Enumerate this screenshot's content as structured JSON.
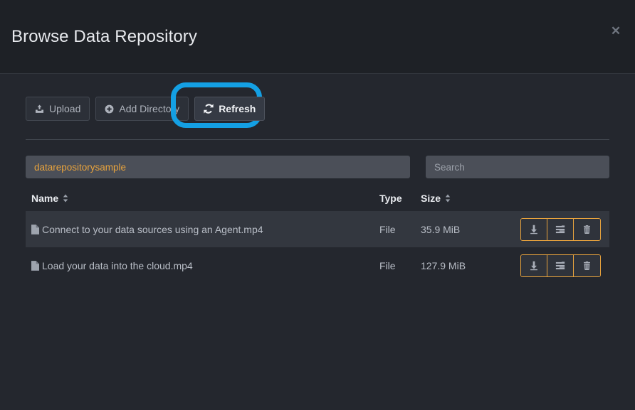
{
  "modal": {
    "title": "Browse Data Repository",
    "close_label": "✕"
  },
  "toolbar": {
    "upload_label": "Upload",
    "add_directory_label": "Add Directory",
    "refresh_label": "Refresh",
    "upload_icon": "upload-icon",
    "add_directory_icon": "plus-circle-icon",
    "refresh_icon": "refresh-icon",
    "highlight_color": "#14a0e4",
    "highlighted_button": "Refresh"
  },
  "filters": {
    "path": "datarepositorysample",
    "path_color": "#e8a33d",
    "search_value": "",
    "search_placeholder": "Search"
  },
  "table": {
    "columns": [
      {
        "label": "Name",
        "sortable": true
      },
      {
        "label": "Type",
        "sortable": false
      },
      {
        "label": "Size",
        "sortable": true
      },
      {
        "label": "",
        "sortable": false
      }
    ],
    "rows": [
      {
        "name": "Connect to your data sources using an Agent.mp4",
        "type": "File",
        "size": "35.9 MiB",
        "icon": "file-icon",
        "hovered": true
      },
      {
        "name": "Load your data into the cloud.mp4",
        "type": "File",
        "size": "127.9 MiB",
        "icon": "file-icon",
        "hovered": false
      }
    ],
    "row_actions": [
      {
        "name": "download-button",
        "icon": "download-arrow-icon"
      },
      {
        "name": "properties-button",
        "icon": "list-lines-icon"
      },
      {
        "name": "delete-button",
        "icon": "trash-icon"
      }
    ],
    "action_border_color": "#e8a33d"
  }
}
